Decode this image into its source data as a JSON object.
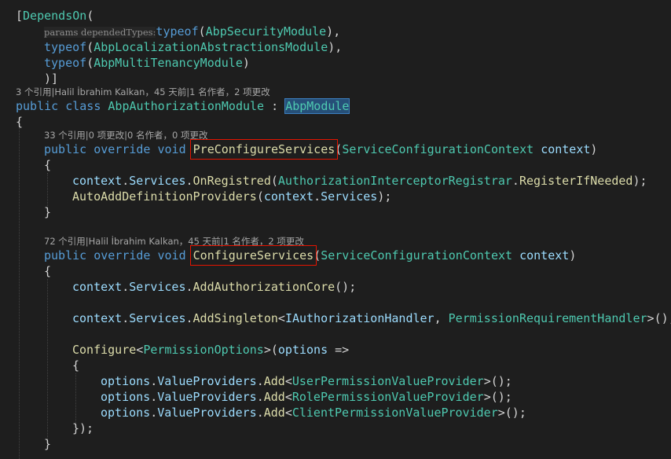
{
  "colors": {
    "background": "#1e1e1e",
    "keyword": "#569cd6",
    "type": "#4ec9b0",
    "method": "#dcdcaa",
    "identifier": "#9cdcfe",
    "punctuation": "#d4d4d4",
    "codelens": "#a7a7a7",
    "highlight_box": "#e51400"
  },
  "code": {
    "attr_open": "[",
    "attr_name": "DependsOn",
    "paren_open": "(",
    "param_hint": "params dependedTypes:",
    "typeof_kw": "typeof",
    "dep1": "AbpSecurityModule",
    "dep2": "AbpLocalizationAbstractionsModule",
    "dep3": "AbpMultiTenancyModule",
    "close_paren": ")",
    "comma": ",",
    "attr_close": ")]",
    "lens_class": "3 个引用|Halil İbrahim Kalkan，45 天前|1 名作者，2 项更改",
    "kw_public": "public",
    "kw_class": "class",
    "class_name": "AbpAuthorizationModule",
    "colon": ":",
    "base_class": "AbpModule",
    "brace_open": "{",
    "brace_close": "}",
    "lens_pre": "33 个引用|0 项更改|0 名作者，0 项更改",
    "kw_override": "override",
    "kw_void": "void",
    "method1": "PreConfigureServices",
    "param_type": "ServiceConfigurationContext",
    "param_name": "context",
    "ctx": "context",
    "dot": ".",
    "services": "Services",
    "on_registred": "OnRegistred",
    "registrar": "AuthorizationInterceptorRegistrar",
    "register_if_needed": "RegisterIfNeeded",
    "stmt_end": ");",
    "auto_add": "AutoAddDefinitionProviders",
    "lens_cfg": "72 个引用|Halil İbrahim Kalkan，45 天前|1 名作者，2 项更改",
    "method2": "ConfigureServices",
    "add_authz_core": "AddAuthorizationCore",
    "call_end": "();",
    "add_singleton": "AddSingleton",
    "lt": "<",
    "gt": ">",
    "authz_handler": "IAuthorizationHandler",
    "perm_req_handler": "PermissionRequirementHandler",
    "configure": "Configure",
    "perm_options": "PermissionOptions",
    "options": "options",
    "arrow": "=>",
    "value_providers": "ValueProviders",
    "add": "Add",
    "user_provider": "UserPermissionValueProvider",
    "role_provider": "RolePermissionValueProvider",
    "client_provider": "ClientPermissionValueProvider",
    "lambda_close": "});"
  }
}
